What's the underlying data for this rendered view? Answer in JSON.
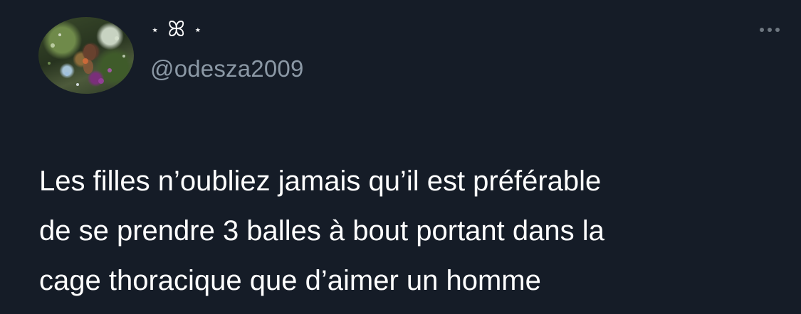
{
  "tweet": {
    "display_name": {
      "star_left": "⋆",
      "glyph": "ꕤ",
      "star_right": "⋆"
    },
    "handle": "@odesza2009",
    "text_lines": [
      "Les filles n’oubliez jamais qu’il est préférable",
      "de se prendre 3 balles à bout portant dans la",
      "cage thoracique que d’aimer un homme"
    ],
    "more_icon": "ellipsis-icon"
  },
  "colors": {
    "background": "#151c27",
    "text": "#ffffff",
    "handle": "#8b98a5",
    "more_dots": "#6e7780"
  }
}
